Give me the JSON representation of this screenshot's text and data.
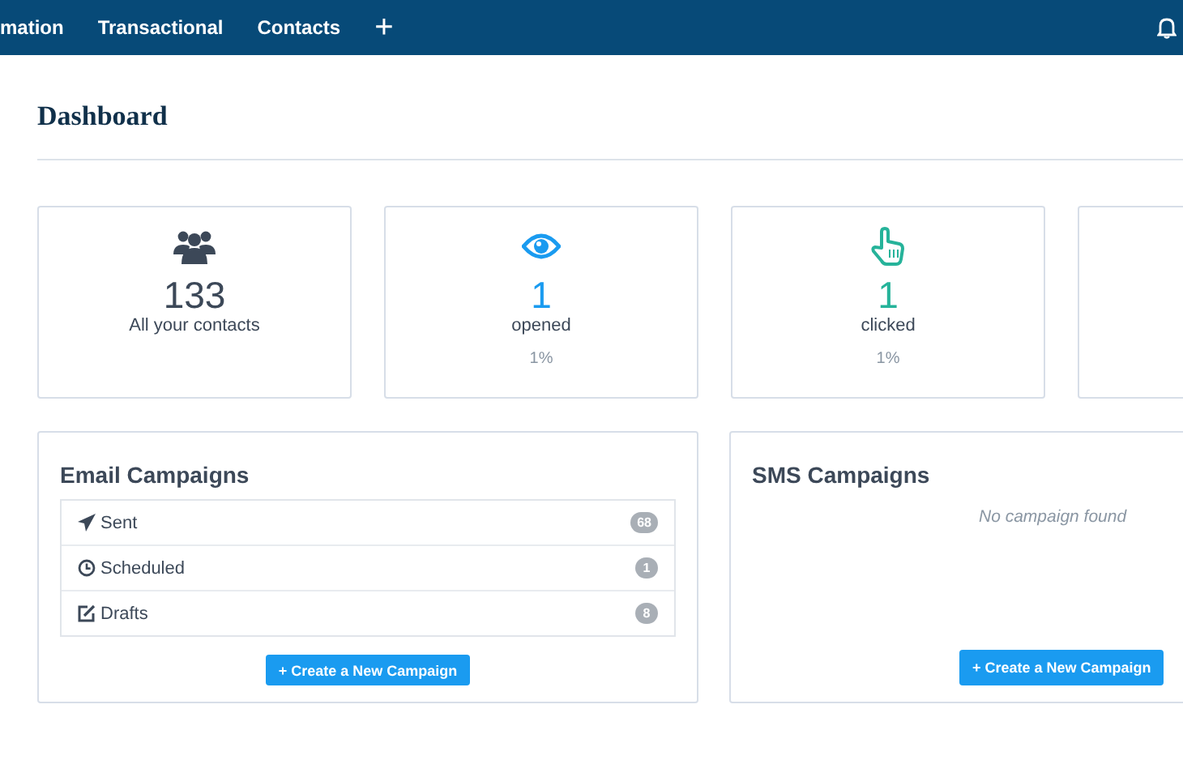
{
  "nav": {
    "items": [
      {
        "label": "mation"
      },
      {
        "label": "Transactional"
      },
      {
        "label": "Contacts"
      }
    ],
    "add": "+"
  },
  "page": {
    "title": "Dashboard"
  },
  "stats": [
    {
      "kind": "contacts",
      "value": "133",
      "label": "All your contacts"
    },
    {
      "kind": "opened",
      "value": "1",
      "label": "opened",
      "percent": "1%"
    },
    {
      "kind": "clicked",
      "value": "1",
      "label": "clicked",
      "percent": "1%"
    }
  ],
  "email_campaigns": {
    "title": "Email Campaigns",
    "rows": [
      {
        "kind": "sent",
        "label": "Sent",
        "count": "68"
      },
      {
        "kind": "scheduled",
        "label": "Scheduled",
        "count": "1"
      },
      {
        "kind": "drafts",
        "label": "Drafts",
        "count": "8"
      }
    ],
    "button": "+ Create a New Campaign"
  },
  "sms_campaigns": {
    "title": "SMS Campaigns",
    "empty": "No campaign found",
    "button": "+ Create a New Campaign"
  }
}
